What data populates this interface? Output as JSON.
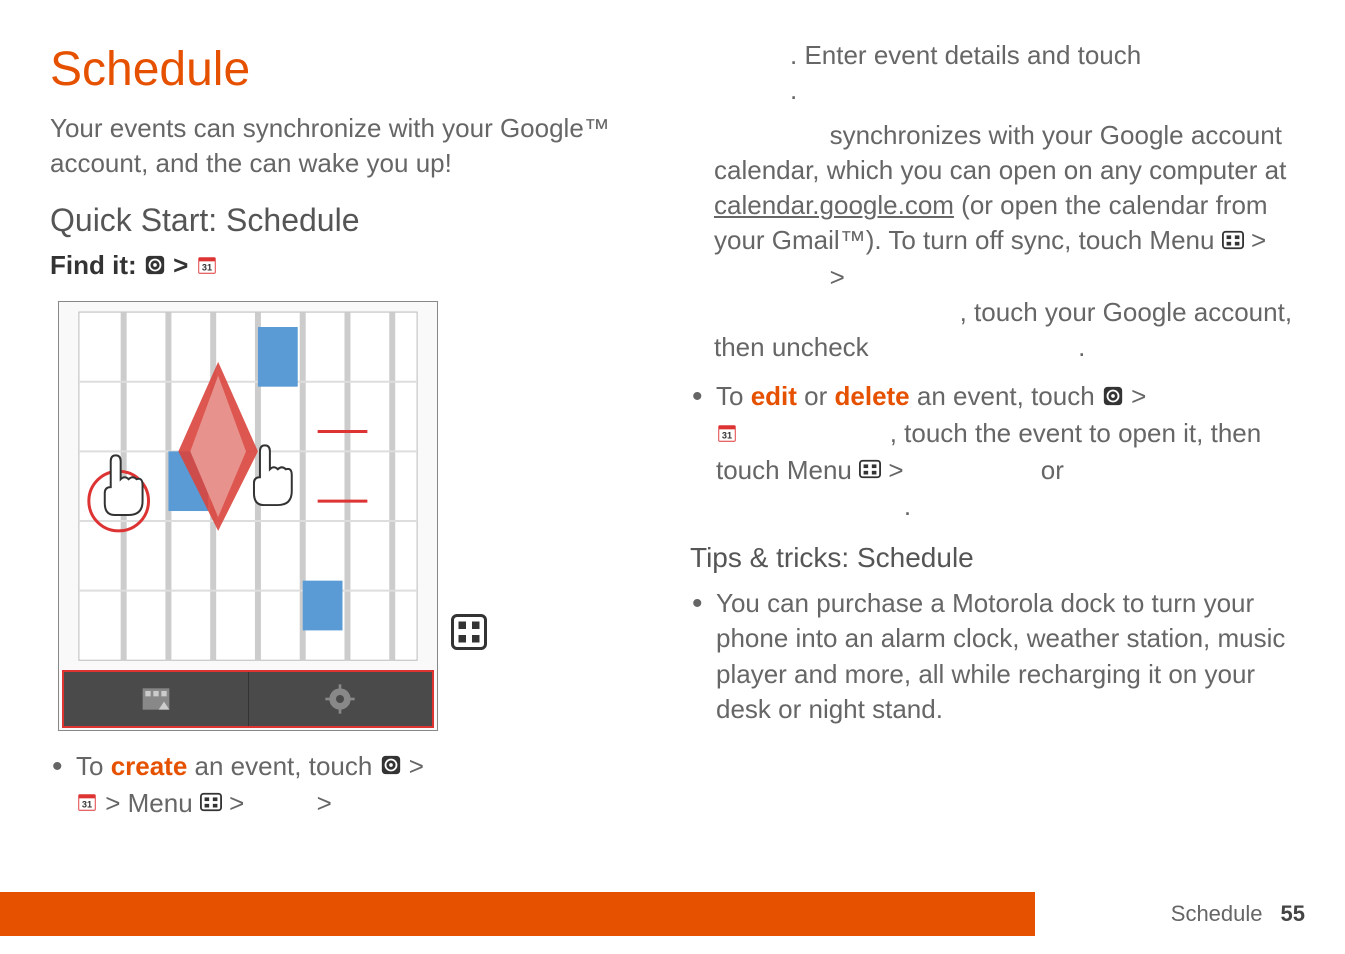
{
  "page": {
    "title": "Schedule",
    "intro_parts": {
      "p1": "Your ",
      "p2": " events can synchronize with your Google™ account, and the ",
      "p3": " can wake you up!"
    },
    "quick_start_heading": "Quick Start: Schedule",
    "find_it_label": "Find it:",
    "find_it_sep": " > ",
    "left_bullets": {
      "create": {
        "p1": "To ",
        "kw": "create",
        "p2": " an event, touch ",
        "sep1": " > ",
        "p3": " > Menu ",
        "sep2": " > ",
        "sep3": " > "
      }
    },
    "right_top": {
      "continuation": ". Enter event details and touch ",
      "period1": ".",
      "sync_para": {
        "p1": " synchronizes with your Google account calendar, which you can open on any computer at ",
        "link": "calendar.google.com",
        "p2": " (or open the calendar from your Gmail™). To turn off sync, touch Menu ",
        "sep1": " > ",
        "sep2": " > ",
        "p3": ", touch your Google account, then uncheck ",
        "period": "."
      }
    },
    "right_bullets": {
      "edit_delete": {
        "p1": "To ",
        "kw1": "edit",
        "or1": " or ",
        "kw2": "delete",
        "p2": " an event, touch ",
        "sep1": " > ",
        "p3": ", touch the event to open it, then touch Menu ",
        "sep2": " > ",
        "or2": " or",
        "period": "."
      }
    },
    "tips_heading": "Tips & tricks: Schedule",
    "tips_bullets": [
      "You can purchase a Motorola dock to turn your phone into an alarm clock, weather station, music player and more, all while recharging it on your desk or night stand."
    ],
    "footer": {
      "section": "Schedule",
      "page_num": "55"
    }
  }
}
